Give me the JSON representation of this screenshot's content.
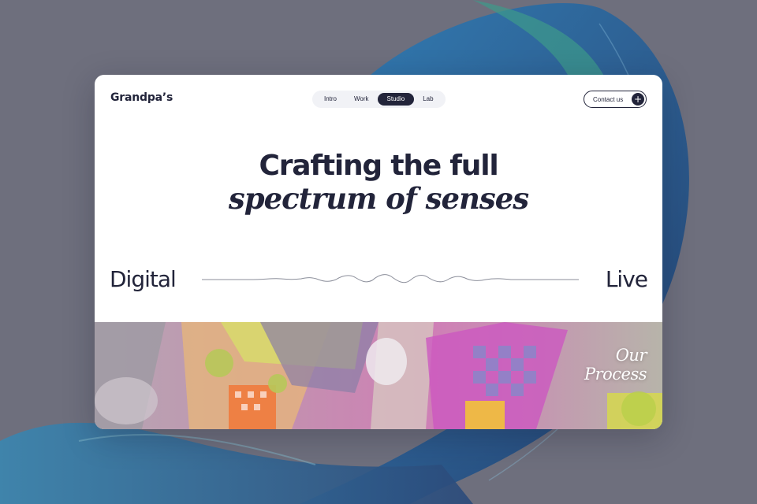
{
  "brand": {
    "logo": "Grandpa’s"
  },
  "nav": {
    "items": [
      {
        "label": "Intro",
        "active": false
      },
      {
        "label": "Work",
        "active": false
      },
      {
        "label": "Studio",
        "active": true
      },
      {
        "label": "Lab",
        "active": false
      }
    ]
  },
  "contact": {
    "label": "Contact us",
    "icon": "plus-icon"
  },
  "hero": {
    "line1": "Crafting the full",
    "line2": "spectrum of senses"
  },
  "spectrum": {
    "left": "Digital",
    "right": "Live"
  },
  "process": {
    "line1": "Our",
    "line2": "Process"
  },
  "colors": {
    "page_background": "#6e6f7d",
    "card": "#ffffff",
    "ink": "#22243a",
    "nav_pill": "#f1f2f6"
  }
}
